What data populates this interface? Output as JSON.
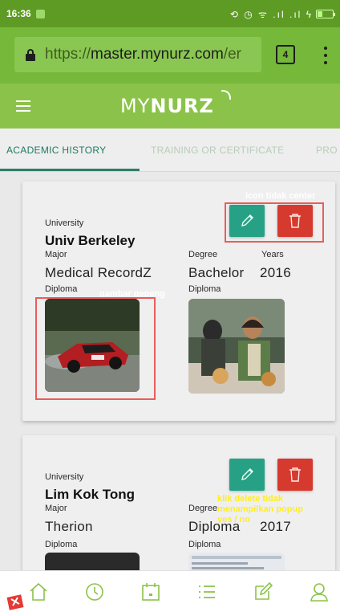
{
  "status_bar": {
    "time": "16:36",
    "system_icons": "⟲ ◷ ᯤ .ıl .ıl ϟ"
  },
  "browser": {
    "url_scheme": "https://",
    "url_host": "master.mynurz.com",
    "url_rest": "/er",
    "tab_count": "4"
  },
  "app": {
    "brand_light": "MY",
    "brand_bold": "NURZ"
  },
  "tabs": [
    {
      "label": "ACADEMIC HISTORY",
      "active": true
    },
    {
      "label": "TRAINING OR CERTIFICATE",
      "active": false
    },
    {
      "label": "PRO",
      "active": false
    }
  ],
  "cards": [
    {
      "university_label": "University",
      "university": "Univ Berkeley",
      "major_label": "Major",
      "major": "Medical RecordZ",
      "degree_label": "Degree",
      "degree": "Bachelor",
      "years_label": "Years",
      "years": "2016",
      "diploma_label": "Diploma",
      "diploma_label_2": "Diploma"
    },
    {
      "university_label": "University",
      "university": "Lim Kok Tong",
      "major_label": "Major",
      "major": "Therion",
      "degree_label": "Degree",
      "degree": "Diploma",
      "years": "2017",
      "diploma_label": "Diploma",
      "diploma_label_2": "Diploma"
    }
  ],
  "annotations": {
    "icon_not_center": "icon tidak center",
    "image_flat": "gambar gepeng",
    "delete_no_popup_1": "klik delete tidak",
    "delete_no_popup_2": "menampilkan popup",
    "delete_no_popup_3": "yes / no"
  },
  "colors": {
    "status_bar": "#5e9b24",
    "app_header": "#8bc34a",
    "edit_button": "#26a185",
    "delete_button": "#d63a2f",
    "accent_tab": "#1f7a62",
    "annotation_red": "#e85d5d",
    "annotation_yellow": "#ffee22"
  },
  "bottom_nav": [
    {
      "icon": "home-icon"
    },
    {
      "icon": "clock-icon"
    },
    {
      "icon": "calendar-icon"
    },
    {
      "icon": "list-icon"
    },
    {
      "icon": "edit-icon"
    },
    {
      "icon": "user-icon"
    }
  ]
}
